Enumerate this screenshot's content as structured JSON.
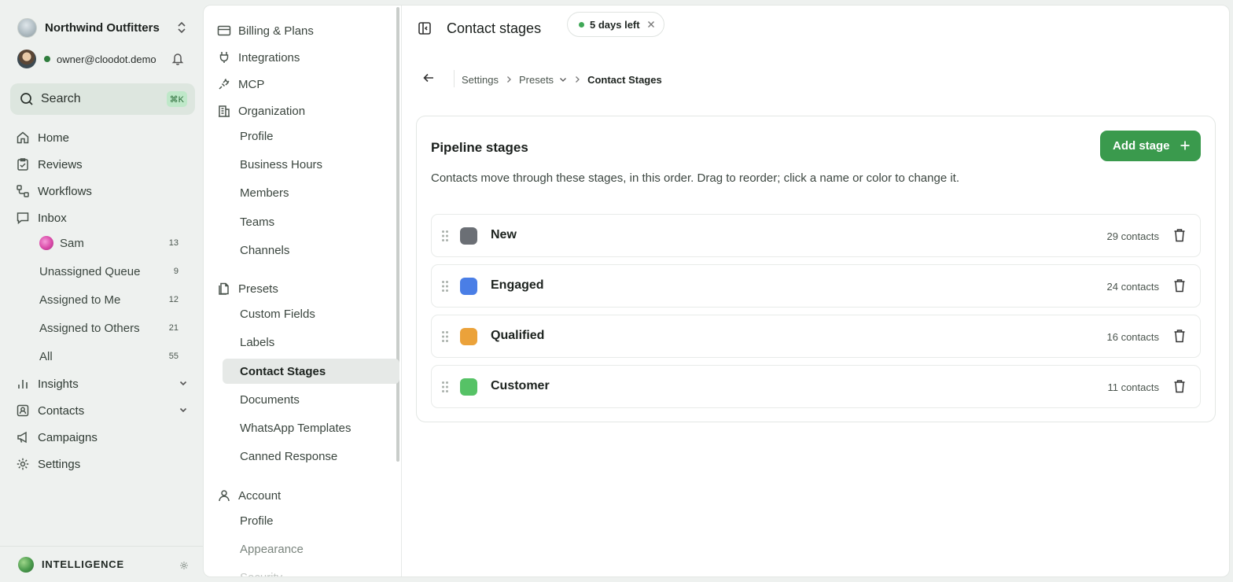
{
  "sidebar": {
    "org_name": "Northwind Outfitters",
    "user_email": "owner@cloodot.demo",
    "search_label": "Search",
    "search_shortcut": "⌘K",
    "nav": {
      "home": "Home",
      "reviews": "Reviews",
      "workflows": "Workflows",
      "inbox": "Inbox",
      "insights": "Insights",
      "contacts": "Contacts",
      "campaigns": "Campaigns",
      "settings": "Settings"
    },
    "inbox_items": [
      {
        "label": "Sam",
        "count": "13"
      },
      {
        "label": "Unassigned Queue",
        "count": "9"
      },
      {
        "label": "Assigned to Me",
        "count": "12"
      },
      {
        "label": "Assigned to Others",
        "count": "21"
      },
      {
        "label": "All",
        "count": "55"
      }
    ],
    "intelligence_label": "INTELLIGENCE"
  },
  "settings_nav": {
    "billing": "Billing & Plans",
    "integrations": "Integrations",
    "mcp": "MCP",
    "organization": "Organization",
    "org_items": [
      "Profile",
      "Business Hours",
      "Members",
      "Teams",
      "Channels"
    ],
    "presets": "Presets",
    "preset_items": [
      "Custom Fields",
      "Labels",
      "Contact Stages",
      "Documents",
      "WhatsApp Templates",
      "Canned Response"
    ],
    "account": "Account",
    "account_items": [
      "Profile",
      "Appearance",
      "Security"
    ]
  },
  "header": {
    "title": "Contact stages",
    "trial_label": "5 days left"
  },
  "breadcrumb": {
    "items": [
      "Settings",
      "Presets",
      "Contact Stages"
    ]
  },
  "card": {
    "title": "Pipeline stages",
    "add_button": "Add stage",
    "description": "Contacts move through these stages, in this order. Drag to reorder; click a name or color to change it."
  },
  "stages": [
    {
      "name": "New",
      "count": "29 contacts",
      "color": "#6b6f75"
    },
    {
      "name": "Engaged",
      "count": "24 contacts",
      "color": "#4a7ee6"
    },
    {
      "name": "Qualified",
      "count": "16 contacts",
      "color": "#eba23a"
    },
    {
      "name": "Customer",
      "count": "11 contacts",
      "color": "#56c266"
    }
  ],
  "colors": {
    "accent": "#3a9a4d",
    "sidebar_bg": "#eef1ef",
    "active_item_bg": "#e6e9e7"
  }
}
